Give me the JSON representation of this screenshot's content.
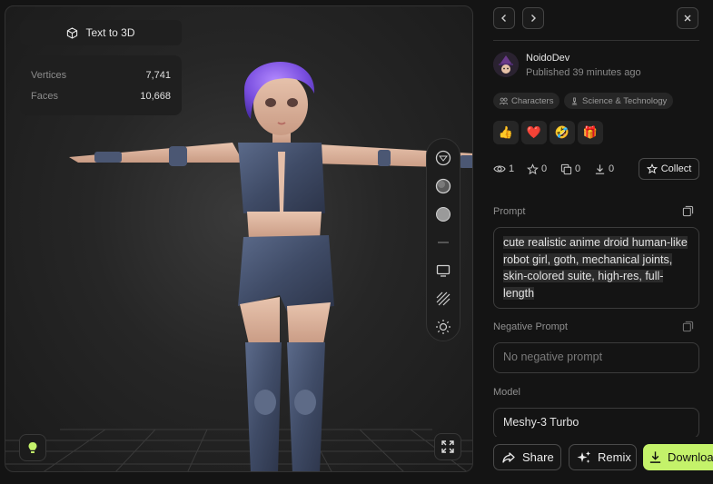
{
  "viewer": {
    "model_tag": "Text to 3D",
    "stats": [
      {
        "label": "Vertices",
        "value": "7,741"
      },
      {
        "label": "Faces",
        "value": "10,668"
      }
    ],
    "tools": [
      "texture-icon",
      "clay-shading-icon",
      "solid-shading-icon",
      "separator",
      "monitor-icon",
      "wireframe-icon",
      "lighting-icon"
    ],
    "corner_left_icon": "lightbulb-icon",
    "corner_right_icon": "fullscreen-icon"
  },
  "panel": {
    "author": "NoidoDev",
    "published": "Published 39 minutes ago",
    "tags": [
      "Characters",
      "Science & Technology"
    ],
    "reactions": [
      "👍",
      "❤️",
      "🤣",
      "🎁"
    ],
    "counters": {
      "views": "1",
      "likes": "0",
      "remixes": "0",
      "downloads": "0"
    },
    "collect_label": "Collect",
    "prompt_label": "Prompt",
    "prompt_text": "cute realistic anime droid human-like robot girl, goth, mechanical joints, skin-colored suite, high-res, full-length",
    "negative_prompt_label": "Negative Prompt",
    "negative_prompt_placeholder": "No negative prompt",
    "model_label": "Model",
    "model_value": "Meshy-3 Turbo",
    "actions": {
      "share": "Share",
      "remix": "Remix",
      "download": "Download"
    },
    "accent": "#c4f26a"
  }
}
